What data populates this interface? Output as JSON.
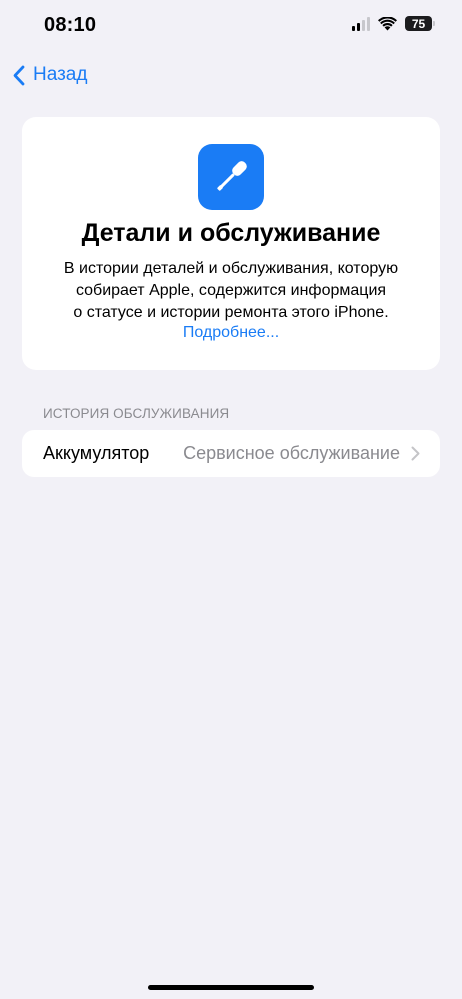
{
  "status_bar": {
    "time": "08:10",
    "battery": "75",
    "icons": [
      "cellular-signal-icon",
      "wifi-icon",
      "battery-icon"
    ]
  },
  "nav": {
    "back_label": "Назад",
    "back_icon": "chevron-left-icon"
  },
  "card": {
    "icon": "screwdriver-icon",
    "icon_color": "#1a7cf5",
    "title": "Детали и обслуживание",
    "description_line1": "В истории деталей и обслуживания, которую",
    "description_line2": "собирает Apple, содержится информация",
    "description_line3": "о статусе и истории ремонта этого iPhone.",
    "link": "Подробнее..."
  },
  "service_history": {
    "header": "ИСТОРИЯ ОБСЛУЖИВАНИЯ",
    "rows": [
      {
        "label": "Аккумулятор",
        "value": "Сервисное обслуживание",
        "icon": "chevron-right-icon"
      }
    ]
  },
  "colors": {
    "accent": "#1a7cf5",
    "background": "#f2f1f7",
    "secondary_text": "#8a8a8f"
  }
}
